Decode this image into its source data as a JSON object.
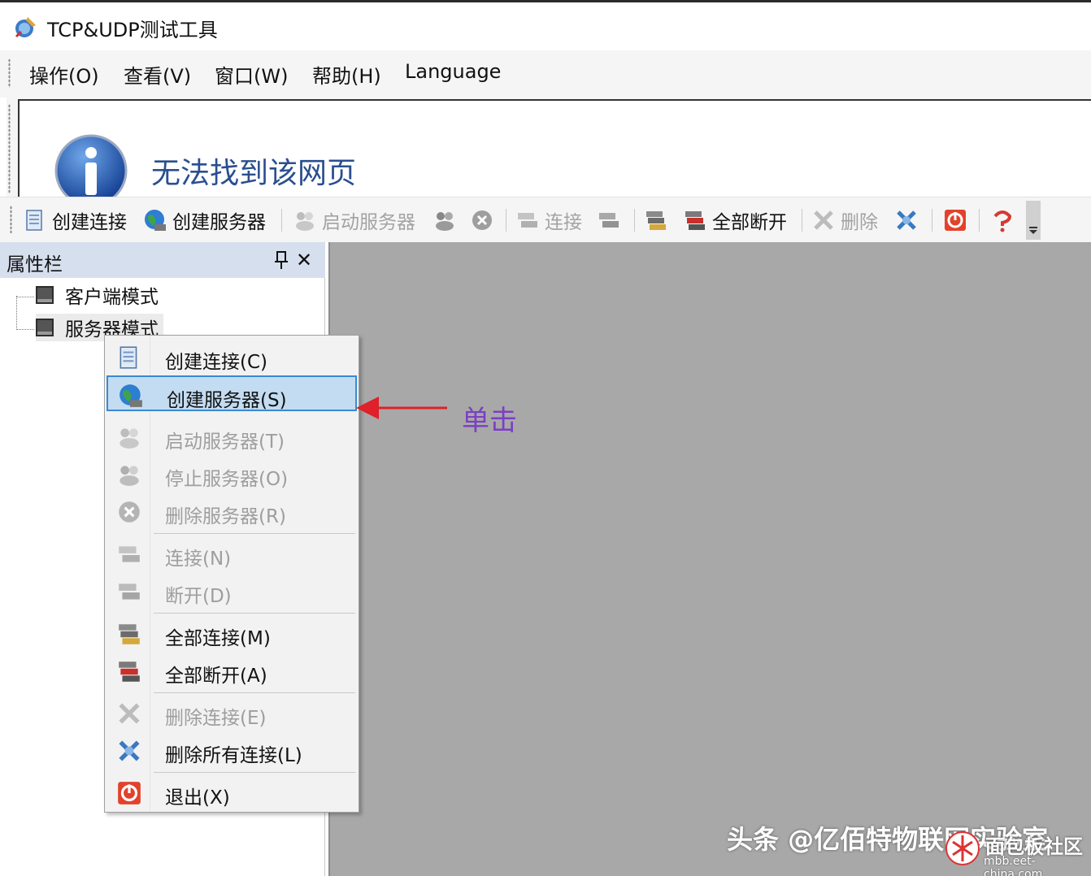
{
  "window": {
    "title": "TCP&UDP测试工具"
  },
  "menubar": {
    "items": [
      {
        "name": "menu-operate",
        "label": "操作(O)"
      },
      {
        "name": "menu-view",
        "label": "查看(V)"
      },
      {
        "name": "menu-window",
        "label": "窗口(W)"
      },
      {
        "name": "menu-help",
        "label": "帮助(H)"
      },
      {
        "name": "menu-language",
        "label": "Language"
      }
    ]
  },
  "browser": {
    "message": "无法找到该网页"
  },
  "toolbar": {
    "create_connection": "创建连接",
    "create_server": "创建服务器",
    "start_server": "启动服务器",
    "connect": "连接",
    "disconnect_all": "全部断开",
    "delete": "删除"
  },
  "panel": {
    "title": "属性栏",
    "close": "✕",
    "tree": [
      {
        "label": "客户端模式"
      },
      {
        "label": "服务器模式"
      }
    ]
  },
  "context_menu": {
    "items": [
      {
        "label": "创建连接(C)",
        "enabled": true
      },
      {
        "label": "创建服务器(S)",
        "enabled": true,
        "highlighted": true
      },
      {
        "label": "启动服务器(T)",
        "enabled": false
      },
      {
        "label": "停止服务器(O)",
        "enabled": false
      },
      {
        "label": "删除服务器(R)",
        "enabled": false
      },
      {
        "label": "连接(N)",
        "enabled": false
      },
      {
        "label": "断开(D)",
        "enabled": false
      },
      {
        "label": "全部连接(M)",
        "enabled": true
      },
      {
        "label": "全部断开(A)",
        "enabled": true
      },
      {
        "label": "删除连接(E)",
        "enabled": false
      },
      {
        "label": "删除所有连接(L)",
        "enabled": true
      },
      {
        "label": "退出(X)",
        "enabled": true
      }
    ]
  },
  "annotation": {
    "text": "单击",
    "color": "#7b3fc4",
    "arrow_color": "#e0202a"
  },
  "watermark": {
    "author": "头条 @亿佰特物联网实验室",
    "site_name": "面包板社区",
    "site_url": "mbb.eet-china.com"
  },
  "colors": {
    "accent": "#3a8ad1",
    "highlight_bg": "#c3dcf2",
    "panel_header": "#d6dfee",
    "workspace": "#a8a8a8",
    "disabled_text": "#9e9e9e"
  }
}
